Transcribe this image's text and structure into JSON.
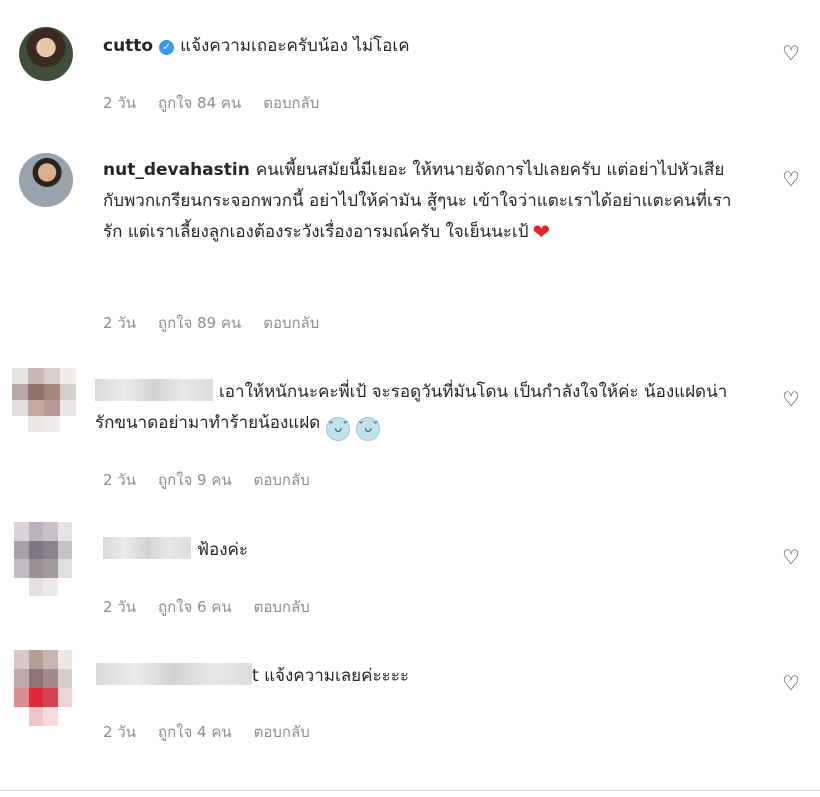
{
  "comments": [
    {
      "username": "cutto",
      "verified": true,
      "text": "แจ้งความเถอะครับน้อง ไม่โอเค",
      "time": "2 วัน",
      "likes": "ถูกใจ 84 คน",
      "reply": "ตอบกลับ"
    },
    {
      "username": "nut_devahastin",
      "text": "คนเพี้ยนสมัยนี้มีเยอะ ให้ทนายจัดการไปเลยครับ แต่อย่าไปหัวเสียกับพวกเกรียนกระจอกพวกนี้ อย่าไปให้ค่ามัน สู้ๆนะ เข้าใจว่าแตะเราได้อย่าแตะคนที่เรารัก แต่เราเลี้ยงลูกเองต้องระวังเรื่องอารมณ์ครับ ใจเย็นนะเป้",
      "time": "2 วัน",
      "likes": "ถูกใจ 89 คน",
      "reply": "ตอบกลับ"
    },
    {
      "username": "",
      "text": "เอาให้หนักนะคะพี่เป้ จะรอดูวันที่มันโดน เป็นกำลังใจให้ค่ะ น้องแฝดน่ารักขนาดอย่ามาทำร้ายน้องแฝด",
      "time": "2 วัน",
      "likes": "ถูกใจ 9 คน",
      "reply": "ตอบกลับ"
    },
    {
      "username": "",
      "text": "ฟ้องค่ะ",
      "time": "2 วัน",
      "likes": "ถูกใจ 6 คน",
      "reply": "ตอบกลับ"
    },
    {
      "username": "",
      "text": "t แจ้งความเลยค่ะะะะ",
      "time": "2 วัน",
      "likes": "ถูกใจ 4 คน",
      "reply": "ตอบกลับ"
    }
  ],
  "icons": {
    "like": "heart-outline-icon",
    "verified": "verified-badge-icon",
    "heart_emoji": "red-heart-emoji",
    "baby_emoji": "baby-face-emoji"
  },
  "colors": {
    "meta_text": "#8e8e8e",
    "verified": "#3897f0",
    "heart": "#e0262b"
  }
}
